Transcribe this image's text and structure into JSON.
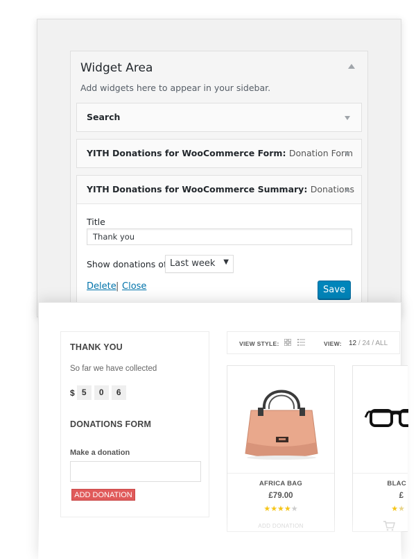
{
  "widget_area": {
    "title": "Widget Area",
    "description": "Add widgets here to appear in your sidebar."
  },
  "widgets": [
    {
      "title": "Search",
      "subtitle": ""
    },
    {
      "title": "YITH Donations for WooCommerce Form:",
      "subtitle": "Donation Form"
    },
    {
      "title": "YITH Donations for WooCommerce Summary:",
      "subtitle": "Donations"
    }
  ],
  "summary_form": {
    "title_label": "Title",
    "title_value": "Thank you",
    "show_label": "Show donations of",
    "period_value": "Last week",
    "delete_label": "Delete",
    "separator": "|",
    "close_label": "Close",
    "save_label": "Save"
  },
  "shop_sidebar": {
    "thank_heading": "THANK YOU",
    "collected_text": "So far we have collected",
    "currency": "$",
    "digits": [
      "5",
      "0",
      "6"
    ],
    "form_heading": "DONATIONS FORM",
    "donation_label": "Make a donation",
    "add_button": "ADD DONATION"
  },
  "toolbar": {
    "view_style_label": "VIEW STYLE:",
    "view_label": "VIEW:",
    "view_active": "12",
    "view_options_rest": " / 24 / ALL"
  },
  "products": [
    {
      "name": "AFRICA BAG",
      "price": "£79.00",
      "rating": 4,
      "max_rating": 5,
      "footer": "ADD DONATION"
    },
    {
      "name": "BLAC",
      "price": "£",
      "rating": 1,
      "max_rating": 5,
      "footer": ""
    }
  ],
  "colors": {
    "primary_button": "#0085ba",
    "link": "#0073aa",
    "donation_button": "#e05a5a",
    "star": "#f5c518"
  },
  "icons": [
    "chevron-up-icon",
    "chevron-down-icon",
    "grid-view-icon",
    "list-view-icon",
    "cart-icon"
  ]
}
